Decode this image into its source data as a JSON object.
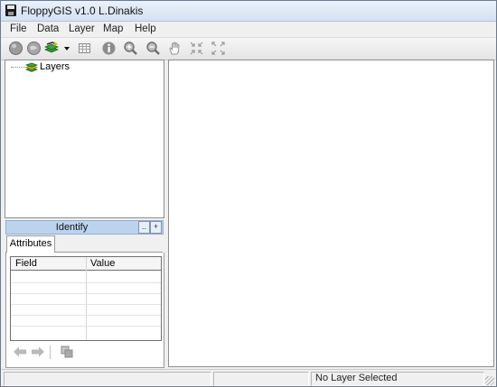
{
  "window": {
    "title": "FloppyGIS v1.0 L.Dinakis",
    "app_icon": "floppy-disk-icon"
  },
  "menu": {
    "items": [
      {
        "label": "File"
      },
      {
        "label": "Data"
      },
      {
        "label": "Layer"
      },
      {
        "label": "Map"
      },
      {
        "label": "Help"
      }
    ]
  },
  "toolbar": {
    "buttons": [
      {
        "icon": "gray-circle-icon"
      },
      {
        "icon": "globe-icon"
      },
      {
        "icon": "add-layer-icon"
      },
      {
        "icon": "dropdown-arrow-icon"
      },
      {
        "icon": "table-icon"
      },
      {
        "icon": "info-icon"
      },
      {
        "icon": "zoom-in-icon"
      },
      {
        "icon": "zoom-out-icon"
      },
      {
        "icon": "pan-hand-icon"
      },
      {
        "icon": "zoom-extent-in-icon"
      },
      {
        "icon": "zoom-extent-out-icon"
      }
    ]
  },
  "layers_tree": {
    "root_label": "Layers"
  },
  "identify": {
    "title": "Identify",
    "buttons": [
      "..",
      "+"
    ]
  },
  "attributes": {
    "tab_label": "Attributes",
    "columns": [
      "Field",
      "Value"
    ],
    "rows": []
  },
  "statusbar": {
    "cells": [
      "",
      "",
      "No Layer Selected"
    ]
  },
  "colors": {
    "identify_bar": "#bcd3ee",
    "titlebar": "#d3e1f1",
    "window_bg": "#f0f0f0"
  }
}
